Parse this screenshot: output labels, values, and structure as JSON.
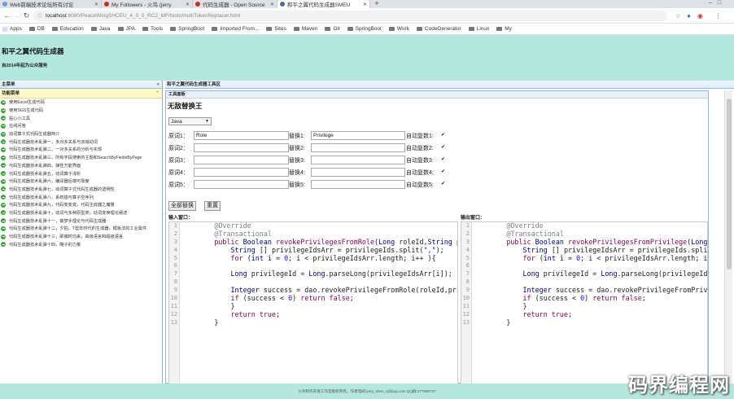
{
  "browser": {
    "tabs": [
      {
        "label": "Web前端技术论坛所有讨论",
        "icon": "generic-page-icon",
        "color": "#6b9bd8"
      },
      {
        "label": "My Followers - 火鸟 (jerry",
        "icon": "csdn-icon",
        "color": "#c9302c"
      },
      {
        "label": "代码生成器 - Open Source",
        "icon": "oschina-icon",
        "color": "#c9302c"
      },
      {
        "label": "和平之翼代码生成器SMEU",
        "icon": "generic-page-icon",
        "color": "#4a6fa5"
      }
    ],
    "active_tab": 3,
    "address": {
      "host": "localhost",
      "path": ":8080/PeaceWingSHCEU_4_0_0_RC2_MF/tools/multiTokenReplacer.html"
    },
    "bookmarks": [
      {
        "label": "Apps",
        "icon": "apps-grid-icon"
      },
      {
        "label": "DB",
        "icon": "folder-icon"
      },
      {
        "label": "Education",
        "icon": "folder-icon"
      },
      {
        "label": "Java",
        "icon": "folder-icon"
      },
      {
        "label": "JPA",
        "icon": "folder-icon"
      },
      {
        "label": "Tools",
        "icon": "folder-icon"
      },
      {
        "label": "SpringBoot",
        "icon": "folder-icon"
      },
      {
        "label": "Imported From...",
        "icon": "folder-icon"
      },
      {
        "label": "Sites",
        "icon": "folder-icon"
      },
      {
        "label": "Maven",
        "icon": "folder-icon"
      },
      {
        "label": "Git",
        "icon": "folder-icon"
      },
      {
        "label": "SpringBoot",
        "icon": "folder-icon"
      },
      {
        "label": "Work",
        "icon": "folder-icon"
      },
      {
        "label": "CodeGenerator",
        "icon": "folder-icon"
      },
      {
        "label": "Linux",
        "icon": "folder-icon"
      },
      {
        "label": "My",
        "icon": "folder-icon"
      }
    ]
  },
  "header": {
    "title": "和平之翼代码生成器",
    "subtitle": "自2014年起为公众服务",
    "background": "#b4e8df"
  },
  "left_panel": {
    "title": "主菜单",
    "menu_header": "功能菜单",
    "items": [
      "使用Excel生成代码",
      "使用SGS生成代码",
      "贴心小工具",
      "在线问答",
      "动词算子式代码生成器简介",
      "代码生成器技术乱弹一，多对多关系与双域动词",
      "代码生成器技术乱弹二，一对多关系的分析与实现",
      "代码生成器技术乱弹三，所有字段搜索的主题和SearchByFieldsByPage",
      "代码生成器技术乱弹四，弹性万能界面",
      "代码生成器技术乱弹五，动词算子浅析",
      "代码生成器技术乱弹六，编译器后端可靠度",
      "代码生成器技术乱弹七，动词算子式代码生成器的透明性",
      "代码生成器技术乱弹八，系统插与算子空序列",
      "代码生成器技术乱弹九，代码变变变，代码生成器之魔量",
      "代码生成器技术乱弹十，动词与多种原型类，动词变换理论阐述",
      "代码生成器技术乱弹十一，做梦手理论与代码生成器",
      "代码生成器技术乱弹十二，夕拍，T型年时代的生成器，模板法的工业属件",
      "代码生成器技术乱弹十三，即捕时均来，高级语言和超级语言",
      "代码生成器技术乱弹十四，略子的力量"
    ]
  },
  "right_panel": {
    "title": "和平之翼代码生成器工具区",
    "tool_title": "工具面板",
    "heading": "无敌替换王",
    "mode_select": "Java",
    "rows": [
      {
        "orig_label": "原词1：",
        "orig_value": "Role",
        "repl_label": "替换1:",
        "repl_value": "Privilege",
        "plural_label": "自动复数1:",
        "checked": "✔"
      },
      {
        "orig_label": "原词2：",
        "orig_value": "",
        "repl_label": "替换2:",
        "repl_value": "",
        "plural_label": "自动复数2:",
        "checked": "✔"
      },
      {
        "orig_label": "原词3：",
        "orig_value": "",
        "repl_label": "替换3:",
        "repl_value": "",
        "plural_label": "自动复数3:",
        "checked": "✔"
      },
      {
        "orig_label": "原词4：",
        "orig_value": "",
        "repl_label": "替换4:",
        "repl_value": "",
        "plural_label": "自动复数4:",
        "checked": "✔"
      },
      {
        "orig_label": "原词5：",
        "orig_value": "",
        "repl_label": "替换5:",
        "repl_value": "",
        "plural_label": "自动复数5:",
        "checked": "✔"
      }
    ],
    "buttons": {
      "replace_all": "全部替换",
      "reset": "重置"
    },
    "input_label": "输入窗口：",
    "output_label": "输出窗口：",
    "line_numbers": [
      "1",
      "2",
      "3",
      "4",
      "5",
      "6",
      "7",
      "8",
      "9",
      "10",
      "11",
      "12",
      "13"
    ],
    "input_code": [
      [
        {
          "c": "ann",
          "t": "        @Override"
        }
      ],
      [
        {
          "c": "ann",
          "t": "        @Transactional"
        }
      ],
      [
        {
          "c": "kw",
          "t": "        public "
        },
        {
          "c": "typ",
          "t": "Boolean "
        },
        {
          "c": "fn",
          "t": "revokePrivilegesFromRole"
        },
        {
          "c": "",
          "t": "("
        },
        {
          "c": "typ",
          "t": "Long "
        },
        {
          "c": "",
          "t": "roleId,"
        },
        {
          "c": "typ",
          "t": "String "
        },
        {
          "c": "",
          "t": "privilegeIds){"
        }
      ],
      [
        {
          "c": "typ",
          "t": "            String "
        },
        {
          "c": "",
          "t": "[] privilegeIdsArr = privilegeIds.split("
        },
        {
          "c": "str",
          "t": "\",\""
        },
        {
          "c": "",
          "t": ");"
        }
      ],
      [
        {
          "c": "kw",
          "t": "            for "
        },
        {
          "c": "",
          "t": "("
        },
        {
          "c": "typ",
          "t": "int "
        },
        {
          "c": "",
          "t": "i = "
        },
        {
          "c": "str",
          "t": "0"
        },
        {
          "c": "",
          "t": "; i < privilegeIdsArr.length; i++ ){"
        }
      ],
      [
        {
          "c": "",
          "t": ""
        }
      ],
      [
        {
          "c": "typ",
          "t": "            Long "
        },
        {
          "c": "",
          "t": "privilegeId = "
        },
        {
          "c": "typ",
          "t": "Long"
        },
        {
          "c": "",
          "t": ".parseLong(privilegeIdsArr[i]);"
        }
      ],
      [
        {
          "c": "",
          "t": ""
        }
      ],
      [
        {
          "c": "typ",
          "t": "            Integer "
        },
        {
          "c": "",
          "t": "success = dao.revokePrivilegeFromRole(roleId,privilegeId);"
        }
      ],
      [
        {
          "c": "kw",
          "t": "            if "
        },
        {
          "c": "",
          "t": "(success < "
        },
        {
          "c": "str",
          "t": "0"
        },
        {
          "c": "",
          "t": ") "
        },
        {
          "c": "kw",
          "t": "return false"
        },
        {
          "c": "",
          "t": ";"
        }
      ],
      [
        {
          "c": "",
          "t": "            }"
        }
      ],
      [
        {
          "c": "kw",
          "t": "            return true"
        },
        {
          "c": "",
          "t": ";"
        }
      ],
      [
        {
          "c": "",
          "t": "        }"
        }
      ]
    ],
    "output_code": [
      [
        {
          "c": "ann",
          "t": "        @Override"
        }
      ],
      [
        {
          "c": "ann",
          "t": "        @Transactional"
        }
      ],
      [
        {
          "c": "kw",
          "t": "        public "
        },
        {
          "c": "typ",
          "t": "Boolean "
        },
        {
          "c": "fn",
          "t": "revokePrivilegesFromPrivilege"
        },
        {
          "c": "",
          "t": "("
        },
        {
          "c": "typ",
          "t": "Long "
        },
        {
          "c": "",
          "t": "privilegeId,"
        }
      ],
      [
        {
          "c": "typ",
          "t": "            String "
        },
        {
          "c": "",
          "t": "[] privilegeIdsArr = privilegeIds.split("
        },
        {
          "c": "str",
          "t": "\",\""
        },
        {
          "c": "",
          "t": ");"
        }
      ],
      [
        {
          "c": "kw",
          "t": "            for "
        },
        {
          "c": "",
          "t": "("
        },
        {
          "c": "typ",
          "t": "int "
        },
        {
          "c": "",
          "t": "i = "
        },
        {
          "c": "str",
          "t": "0"
        },
        {
          "c": "",
          "t": "; i < privilegeIdsArr.length; i++"
        }
      ],
      [
        {
          "c": "",
          "t": ""
        }
      ],
      [
        {
          "c": "typ",
          "t": "            Long "
        },
        {
          "c": "",
          "t": "privilegeId = "
        },
        {
          "c": "typ",
          "t": "Long"
        },
        {
          "c": "",
          "t": ".parseLong(privilegeIdsArr[i]);"
        }
      ],
      [
        {
          "c": "",
          "t": ""
        }
      ],
      [
        {
          "c": "typ",
          "t": "            Integer "
        },
        {
          "c": "",
          "t": "success = dao.revokePrivilegeFromPrivilege(privilegeId,privilegeId);"
        }
      ],
      [
        {
          "c": "kw",
          "t": "            if "
        },
        {
          "c": "",
          "t": "(success < "
        },
        {
          "c": "str",
          "t": "0"
        },
        {
          "c": "",
          "t": ") "
        },
        {
          "c": "kw",
          "t": "return false"
        },
        {
          "c": "",
          "t": ";"
        }
      ],
      [
        {
          "c": "",
          "t": "            }"
        }
      ],
      [
        {
          "c": "kw",
          "t": "            return true"
        },
        {
          "c": "",
          "t": ";"
        }
      ],
      [
        {
          "c": "",
          "t": "        }"
        }
      ]
    ]
  },
  "footer": {
    "text": "火鸟制作开发工作室版权所有。作者电邮:jerry_shen_sjf@qq.com QQ群:277689737"
  },
  "watermark": "码界编程网"
}
